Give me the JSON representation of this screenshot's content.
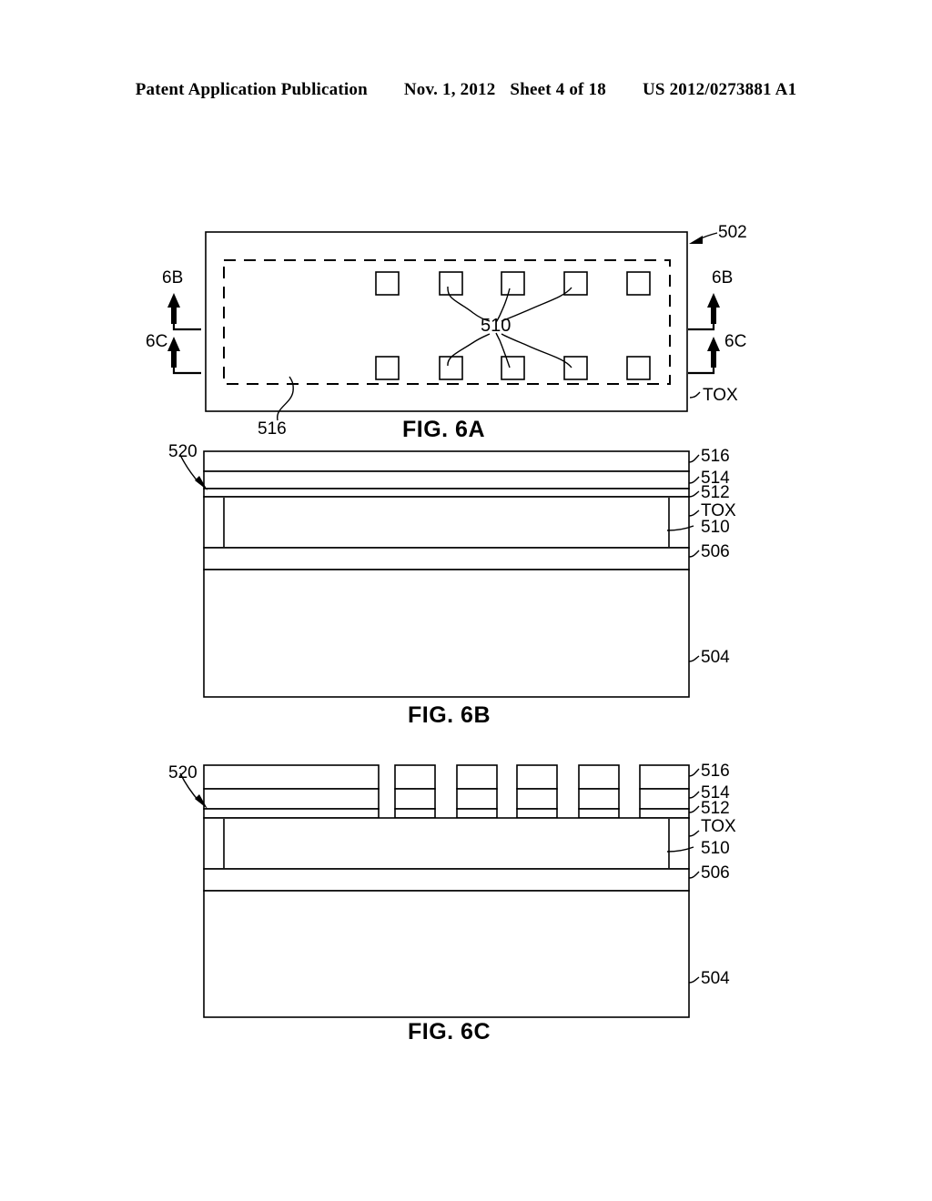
{
  "header": {
    "publication": "Patent Application Publication",
    "date": "Nov. 1, 2012",
    "sheet": "Sheet 4 of 18",
    "patent_number": "US 2012/0273881 A1"
  },
  "figures": [
    {
      "id": "fig-6a",
      "caption": "FIG. 6A",
      "type": "plan-view",
      "labels": {
        "substrate": "502",
        "oxide": "TOX",
        "film": "516",
        "features": "510",
        "section_b_left": "6B",
        "section_b_right": "6B",
        "section_c_left": "6C",
        "section_c_right": "6C"
      },
      "feature_count": 10,
      "feature_rows": 2,
      "features_per_row": 5
    },
    {
      "id": "fig-6b",
      "caption": "FIG. 6B",
      "type": "cross-section",
      "section_line": "6B",
      "stack_label": "520",
      "layers": [
        {
          "name": "516",
          "kind": "blanket"
        },
        {
          "name": "514",
          "kind": "blanket"
        },
        {
          "name": "512",
          "kind": "blanket"
        },
        {
          "name": "TOX",
          "kind": "blanket"
        },
        {
          "name": "510",
          "kind": "embedded-feature"
        },
        {
          "name": "506",
          "kind": "blanket"
        },
        {
          "name": "504",
          "kind": "substrate"
        }
      ]
    },
    {
      "id": "fig-6c",
      "caption": "FIG. 6C",
      "type": "cross-section",
      "section_line": "6C",
      "stack_label": "520",
      "layers": [
        {
          "name": "516",
          "kind": "patterned"
        },
        {
          "name": "514",
          "kind": "patterned"
        },
        {
          "name": "512",
          "kind": "patterned"
        },
        {
          "name": "TOX",
          "kind": "blanket"
        },
        {
          "name": "510",
          "kind": "embedded-feature"
        },
        {
          "name": "506",
          "kind": "blanket"
        },
        {
          "name": "504",
          "kind": "substrate"
        }
      ],
      "patterned_segment_count": 6
    }
  ]
}
